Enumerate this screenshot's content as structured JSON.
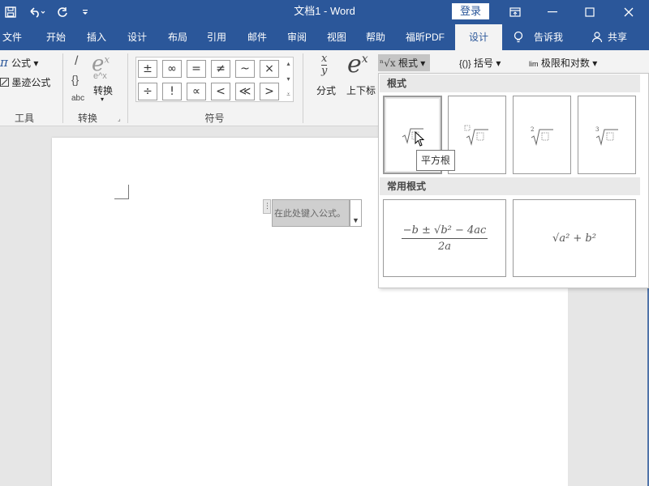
{
  "titlebar": {
    "title": "文档1  -  Word",
    "login_label": "登录",
    "quick_access": [
      "save-icon",
      "undo-icon",
      "redo-icon",
      "customize-icon"
    ]
  },
  "tabs": [
    {
      "label": "文件"
    },
    {
      "label": "开始"
    },
    {
      "label": "插入"
    },
    {
      "label": "设计"
    },
    {
      "label": "布局"
    },
    {
      "label": "引用"
    },
    {
      "label": "邮件"
    },
    {
      "label": "审阅"
    },
    {
      "label": "视图"
    },
    {
      "label": "帮助"
    },
    {
      "label": "福昕PDF"
    },
    {
      "label": "设计"
    }
  ],
  "tell_me": "告诉我",
  "share": "共享",
  "ribbon": {
    "tools": {
      "formula_label": "公式",
      "ink_label": "墨迹公式",
      "group_label": "工具"
    },
    "convert": {
      "convert_label": "转换",
      "abc_label": "abc",
      "group_label": "转换"
    },
    "symbols": {
      "items": [
        "±",
        "∞",
        "=",
        "≠",
        "~",
        "×",
        "÷",
        "!",
        "∝",
        "<",
        "≪",
        ">"
      ],
      "group_label": "符号"
    },
    "structures": {
      "fraction_label": "分式",
      "script_label": "上下标",
      "radical_label": "根式",
      "bracket_label": "括号",
      "limit_label": "极限和对数"
    }
  },
  "document": {
    "equation_placeholder": "在此处键入公式。"
  },
  "radical_panel": {
    "section1_title": "根式",
    "section2_title": "常用根式",
    "tooltip": "平方根",
    "formula_quadratic_num": "−b ± √b² − 4ac",
    "formula_quadratic_den": "2a",
    "formula_pythag": "√a² + b²"
  }
}
